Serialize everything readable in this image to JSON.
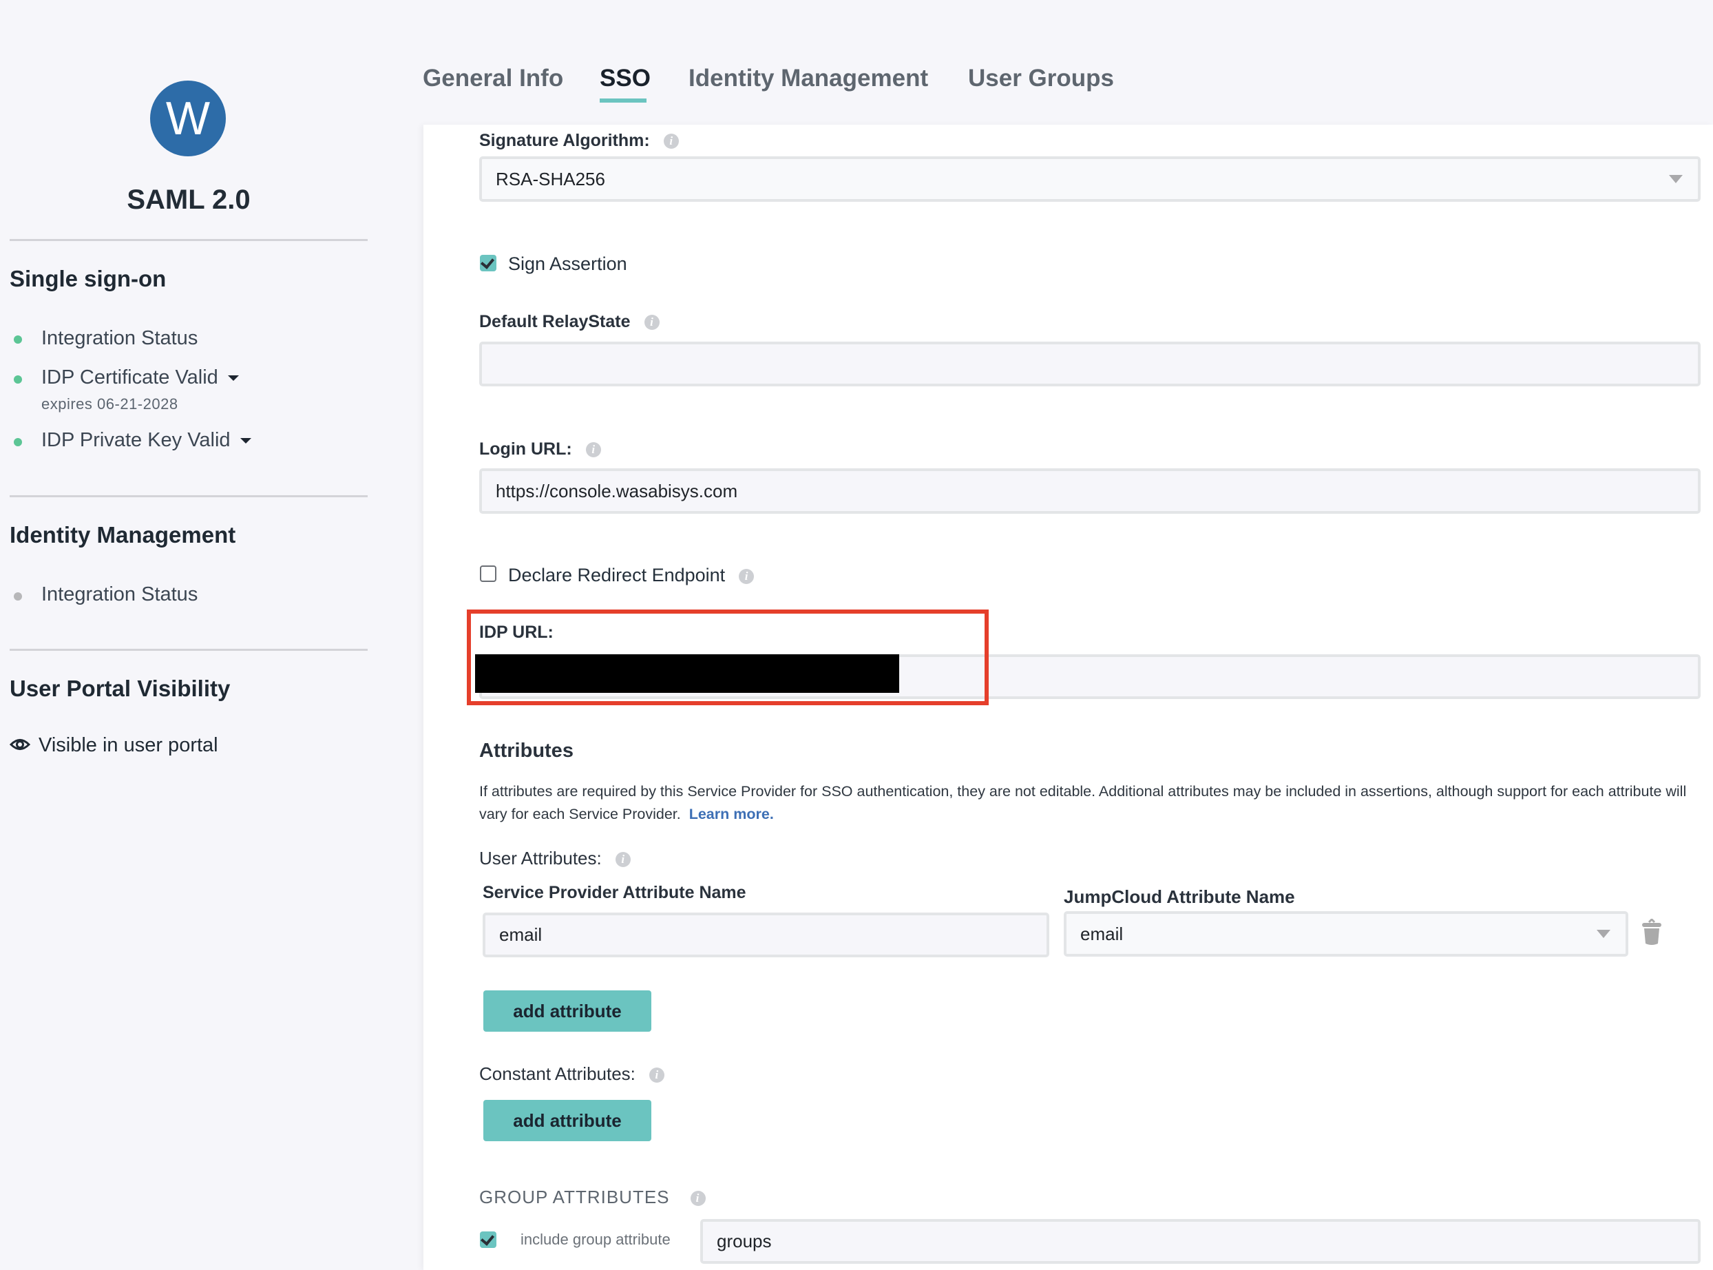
{
  "app": {
    "avatar_letter": "W",
    "name": "SAML 2.0",
    "accent_color": "#6bc4c0",
    "avatar_color": "#2d6ca8",
    "highlight_color": "#e53f2b"
  },
  "sidebar": {
    "single_sign_on": {
      "heading": "Single sign-on",
      "items": [
        {
          "label": "Integration Status",
          "status": "green",
          "has_dropdown": false
        },
        {
          "label": "IDP Certificate Valid",
          "status": "green",
          "has_dropdown": true,
          "subtext": "expires 06-21-2028"
        },
        {
          "label": "IDP Private Key Valid",
          "status": "green",
          "has_dropdown": true
        }
      ]
    },
    "identity_management": {
      "heading": "Identity Management",
      "items": [
        {
          "label": "Integration Status",
          "status": "gray"
        }
      ]
    },
    "user_portal": {
      "heading": "User Portal Visibility",
      "status_label": "Visible in user portal",
      "icon": "eye-icon"
    }
  },
  "tabs": [
    {
      "label": "General Info",
      "active": false
    },
    {
      "label": "SSO",
      "active": true
    },
    {
      "label": "Identity Management",
      "active": false
    },
    {
      "label": "User Groups",
      "active": false
    }
  ],
  "form": {
    "signature_algorithm": {
      "label": "Signature Algorithm:",
      "value": "RSA-SHA256"
    },
    "sign_assertion": {
      "label": "Sign Assertion",
      "checked": true
    },
    "default_relay_state": {
      "label": "Default RelayState",
      "value": ""
    },
    "login_url": {
      "label": "Login URL:",
      "value": "https://console.wasabisys.com"
    },
    "declare_redirect_endpoint": {
      "label": "Declare Redirect Endpoint",
      "checked": false
    },
    "idp_url": {
      "label": "IDP URL:",
      "value_redacted": true
    }
  },
  "attributes": {
    "heading": "Attributes",
    "description": "If attributes are required by this Service Provider for SSO authentication, they are not editable. Additional attributes may be included in assertions, although support for each attribute will vary for each Service Provider.",
    "learn_more": "Learn more.",
    "user_attributes_label": "User Attributes:",
    "columns": {
      "service_provider": "Service Provider Attribute Name",
      "jumpcloud": "JumpCloud Attribute Name"
    },
    "rows": [
      {
        "service_provider": "email",
        "jumpcloud": "email"
      }
    ],
    "add_attribute_label": "add attribute",
    "constant_attributes_label": "Constant Attributes:",
    "constant_add_label": "add attribute"
  },
  "group_attributes": {
    "heading": "GROUP ATTRIBUTES",
    "include_label": "include group attribute",
    "include_checked": true,
    "value": "groups"
  }
}
